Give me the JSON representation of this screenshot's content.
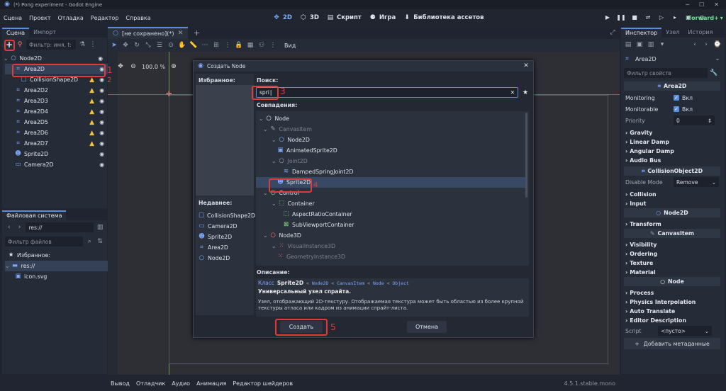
{
  "window": {
    "title": "(*) Pong experiment - Godot Engine"
  },
  "menu": [
    "Сцена",
    "Проект",
    "Отладка",
    "Редактор",
    "Справка"
  ],
  "workspaces": [
    {
      "label": "2D",
      "icon": "workspace-2d-icon",
      "active": true
    },
    {
      "label": "3D",
      "icon": "workspace-3d-icon"
    },
    {
      "label": "Скрипт",
      "icon": "script-icon"
    },
    {
      "label": "Игра",
      "icon": "game-icon"
    },
    {
      "label": "Библиотека ассетов",
      "icon": "asset-library-icon"
    }
  ],
  "renderer": "Forward+",
  "scene_panel": {
    "tabs": [
      "Сцена",
      "Импорт"
    ],
    "filter_placeholder": "Фильтр: имя, t:",
    "nodes": [
      {
        "name": "Node2D",
        "icon": "node2d-icon"
      },
      {
        "name": "Area2D",
        "icon": "area2d-icon"
      },
      {
        "name": "CollisionShape2D",
        "icon": "collisionshape-icon"
      },
      {
        "name": "Area2D2",
        "icon": "area2d-icon"
      },
      {
        "name": "Area2D3",
        "icon": "area2d-icon"
      },
      {
        "name": "Area2D4",
        "icon": "area2d-icon"
      },
      {
        "name": "Area2D5",
        "icon": "area2d-icon"
      },
      {
        "name": "Area2D6",
        "icon": "area2d-icon"
      },
      {
        "name": "Area2D7",
        "icon": "area2d-icon"
      },
      {
        "name": "Sprite2D",
        "icon": "sprite2d-icon"
      },
      {
        "name": "Camera2D",
        "icon": "camera2d-icon"
      }
    ]
  },
  "filesystem": {
    "tab": "Файловая система",
    "path": "res://",
    "filter_placeholder": "Фильтр файлов",
    "items": [
      "Избранное:",
      "res://",
      "icon.svg"
    ]
  },
  "editor": {
    "tab": "[не сохранено](*)",
    "zoom": "100.0 %",
    "view_label": "Вид"
  },
  "dialog": {
    "title": "Создать Node",
    "favorites_label": "Избранное:",
    "recent_label": "Недавнее:",
    "recent": [
      "CollisionShape2D",
      "Camera2D",
      "Sprite2D",
      "Area2D",
      "Node2D"
    ],
    "search_label": "Поиск:",
    "search_value": "spri",
    "matches_label": "Совпадения:",
    "matches": [
      "Node",
      "CanvasItem",
      "Node2D",
      "AnimatedSprite2D",
      "Joint2D",
      "DampedSpringJoint2D",
      "Sprite2D",
      "Control",
      "Container",
      "AspectRatioContainer",
      "SubViewportContainer",
      "Node3D",
      "VisualInstance3D",
      "GeometryInstance3D"
    ],
    "description_label": "Описание:",
    "class_word": "Класс",
    "class_name": "Sprite2D",
    "inheritance": [
      "Node2D",
      "CanvasItem",
      "Node",
      "Object"
    ],
    "summary": "Универсальный узел спрайта.",
    "description": "Узел, отображающий 2D-текстуру. Отображаемая текстура может быть областью из более крупной текстуры атласа или кадром из анимации спрайт-листа.",
    "create_label": "Создать",
    "cancel_label": "Отмена"
  },
  "bottom": {
    "tabs": [
      "Вывод",
      "Отладчик",
      "Аудио",
      "Анимация",
      "Редактор шейдеров"
    ],
    "version": "4.5.1.stable.mono"
  },
  "inspector": {
    "tabs": [
      "Инспектор",
      "Узел",
      "История"
    ],
    "node": "Area2D",
    "filter_placeholder": "Фильтр свойств",
    "class_area": "Area2D",
    "monitoring_label": "Monitoring",
    "monitoring_value": "Вкл",
    "monitorable_label": "Monitorable",
    "monitorable_value": "Вкл",
    "priority_label": "Priority",
    "priority_value": "0",
    "area_sections": [
      "Gravity",
      "Linear Damp",
      "Angular Damp",
      "Audio Bus"
    ],
    "class_collision": "CollisionObject2D",
    "disable_mode_label": "Disable Mode",
    "disable_mode_value": "Remove",
    "collision_sections": [
      "Collision",
      "Input"
    ],
    "class_node2d": "Node2D",
    "node2d_sections": [
      "Transform"
    ],
    "class_canvas": "CanvasItem",
    "canvas_sections": [
      "Visibility",
      "Ordering",
      "Texture",
      "Material"
    ],
    "class_node": "Node",
    "node_sections": [
      "Process",
      "Physics Interpolation",
      "Auto Translate",
      "Editor Description"
    ],
    "script_label": "Script",
    "script_value": "<пусто>",
    "add_meta_label": "Добавить метаданные"
  },
  "annotations": [
    "1",
    "2",
    "3",
    "4",
    "5"
  ],
  "colors": {
    "accent": "#5a8fe0",
    "annotation": "#e23a3a",
    "warning": "#f3c23c",
    "selection": "#384a63"
  }
}
